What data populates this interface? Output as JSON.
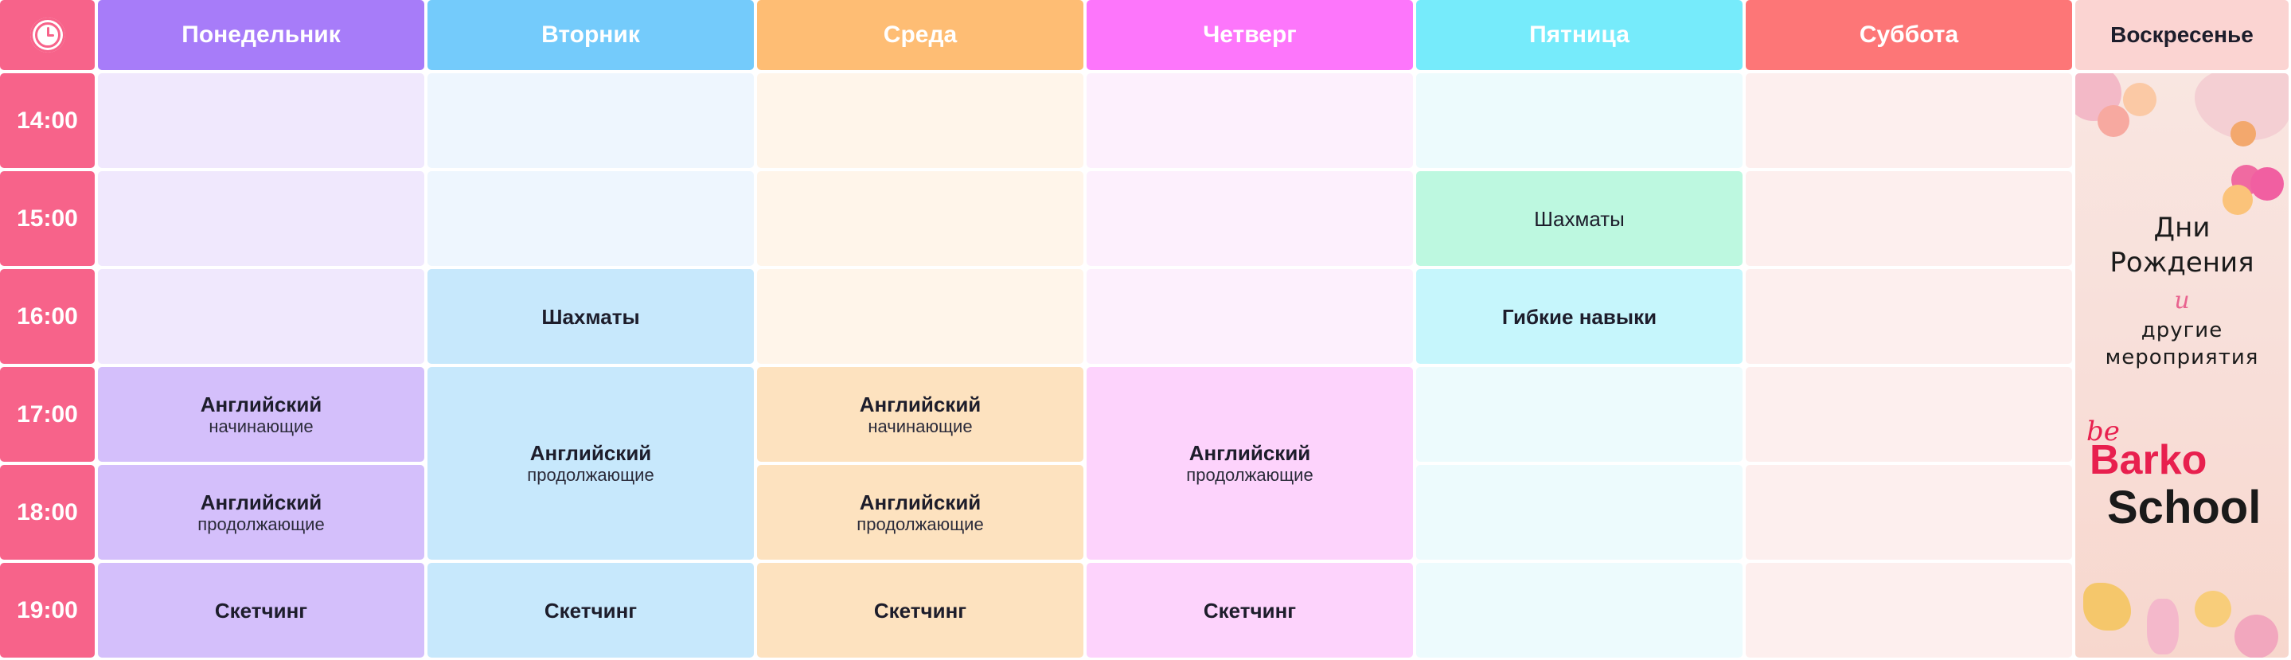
{
  "days": [
    {
      "label": "Понедельник",
      "color": "#a77cf9"
    },
    {
      "label": "Вторник",
      "color": "#74cbfb"
    },
    {
      "label": "Среда",
      "color": "#febd74"
    },
    {
      "label": "Четверг",
      "color": "#fd76fb"
    },
    {
      "label": "Пятница",
      "color": "#76ebfb"
    },
    {
      "label": "Суббота",
      "color": "#fd7677"
    },
    {
      "label": "Воскресенье",
      "color": "#fbd4d2"
    }
  ],
  "clock_icon": "clock-icon",
  "times": [
    "14:00",
    "15:00",
    "16:00",
    "17:00",
    "18:00",
    "19:00"
  ],
  "lessons": {
    "mon_eng_beg": {
      "title": "Английский",
      "subtitle": "начинающие",
      "color": "#d4bffb"
    },
    "mon_eng_cont": {
      "title": "Английский",
      "subtitle": "продолжающие",
      "color": "#d4bffb"
    },
    "mon_sketch": {
      "title": "Скетчинг",
      "color": "#d4bffb"
    },
    "tue_chess": {
      "title": "Шахматы",
      "color": "#c7e8fc"
    },
    "tue_eng_cont": {
      "title": "Английский",
      "subtitle": "продолжающие",
      "color": "#c7e8fc"
    },
    "tue_sketch": {
      "title": "Скетчинг",
      "color": "#c7e8fc"
    },
    "wed_eng_beg": {
      "title": "Английский",
      "subtitle": "начинающие",
      "color": "#fde2bf"
    },
    "wed_eng_cont": {
      "title": "Английский",
      "subtitle": "продолжающие",
      "color": "#fde2bf"
    },
    "wed_sketch": {
      "title": "Скетчинг",
      "color": "#fde2bf"
    },
    "thu_eng_cont": {
      "title": "Английский",
      "subtitle": "продолжающие",
      "color": "#fdd3fc"
    },
    "thu_sketch": {
      "title": "Скетчинг",
      "color": "#fdd3fc"
    },
    "fri_chess": {
      "title": "Шахматы",
      "color": "#bdf8e0"
    },
    "fri_soft": {
      "title": "Гибкие навыки",
      "color": "#c6f6fc"
    }
  },
  "sunday_promo": {
    "line1": "Дни",
    "line2": "Рождения",
    "and": "и",
    "line3": "другие",
    "line4": "мероприятия",
    "brand_script": "be",
    "brand_top": "Barko",
    "brand_bottom": "School"
  },
  "colors": {
    "time_column": "#f7638a",
    "sunday_header_text": "#1d1d2b"
  }
}
